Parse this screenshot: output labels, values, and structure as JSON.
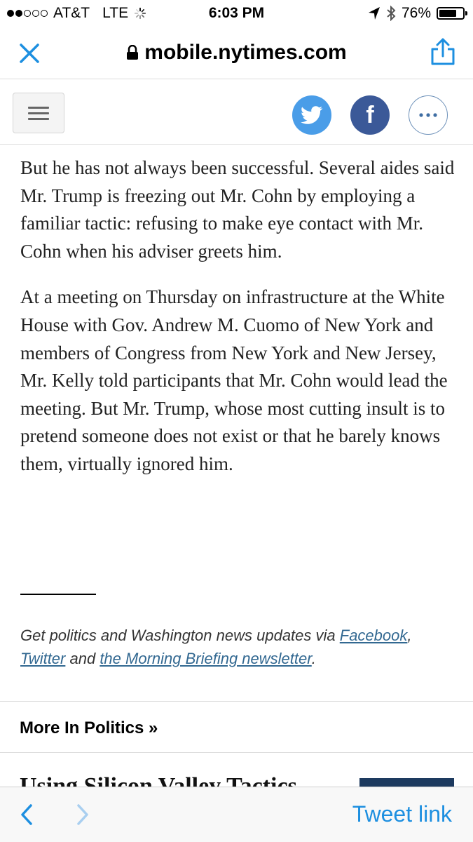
{
  "status_bar": {
    "carrier": "AT&T",
    "network": "LTE",
    "time": "6:03 PM",
    "battery": "76%",
    "battery_level": 0.76,
    "signal_bars_filled": 2,
    "signal_bars_total": 5
  },
  "browser": {
    "url": "mobile.nytimes.com"
  },
  "toolbar": {
    "facebook_glyph": "f"
  },
  "article": {
    "paragraphs": [
      "But he has not always been successful. Several aides said Mr. Trump is freezing out Mr. Cohn by employing a familiar tactic: refusing to make eye contact with Mr. Cohn when his adviser greets him.",
      "At a meeting on Thursday on infrastructure at the White House with Gov. Andrew M. Cuomo of New York and members of Congress from New York and New Jersey, Mr. Kelly told participants that Mr. Cohn would lead the meeting. But Mr. Trump, whose most cutting insult is to pretend someone does not exist or that he barely knows them, virtually ignored him."
    ]
  },
  "promo": {
    "prefix": "Get politics and Washington news updates via ",
    "facebook_link": "Facebook",
    "comma": ",",
    "twitter_link": "Twitter",
    "and": " and ",
    "newsletter_link": "the Morning Briefing newsletter",
    "suffix": "."
  },
  "more": {
    "title": "More In Politics »",
    "next_headline": "Using Silicon Valley Tactics"
  },
  "bottom_bar": {
    "tweet_link": "Tweet link"
  },
  "colors": {
    "twitter": "#4a9de8",
    "facebook": "#3b5998",
    "link": "#326891",
    "ios_blue": "#1d8fe0"
  }
}
